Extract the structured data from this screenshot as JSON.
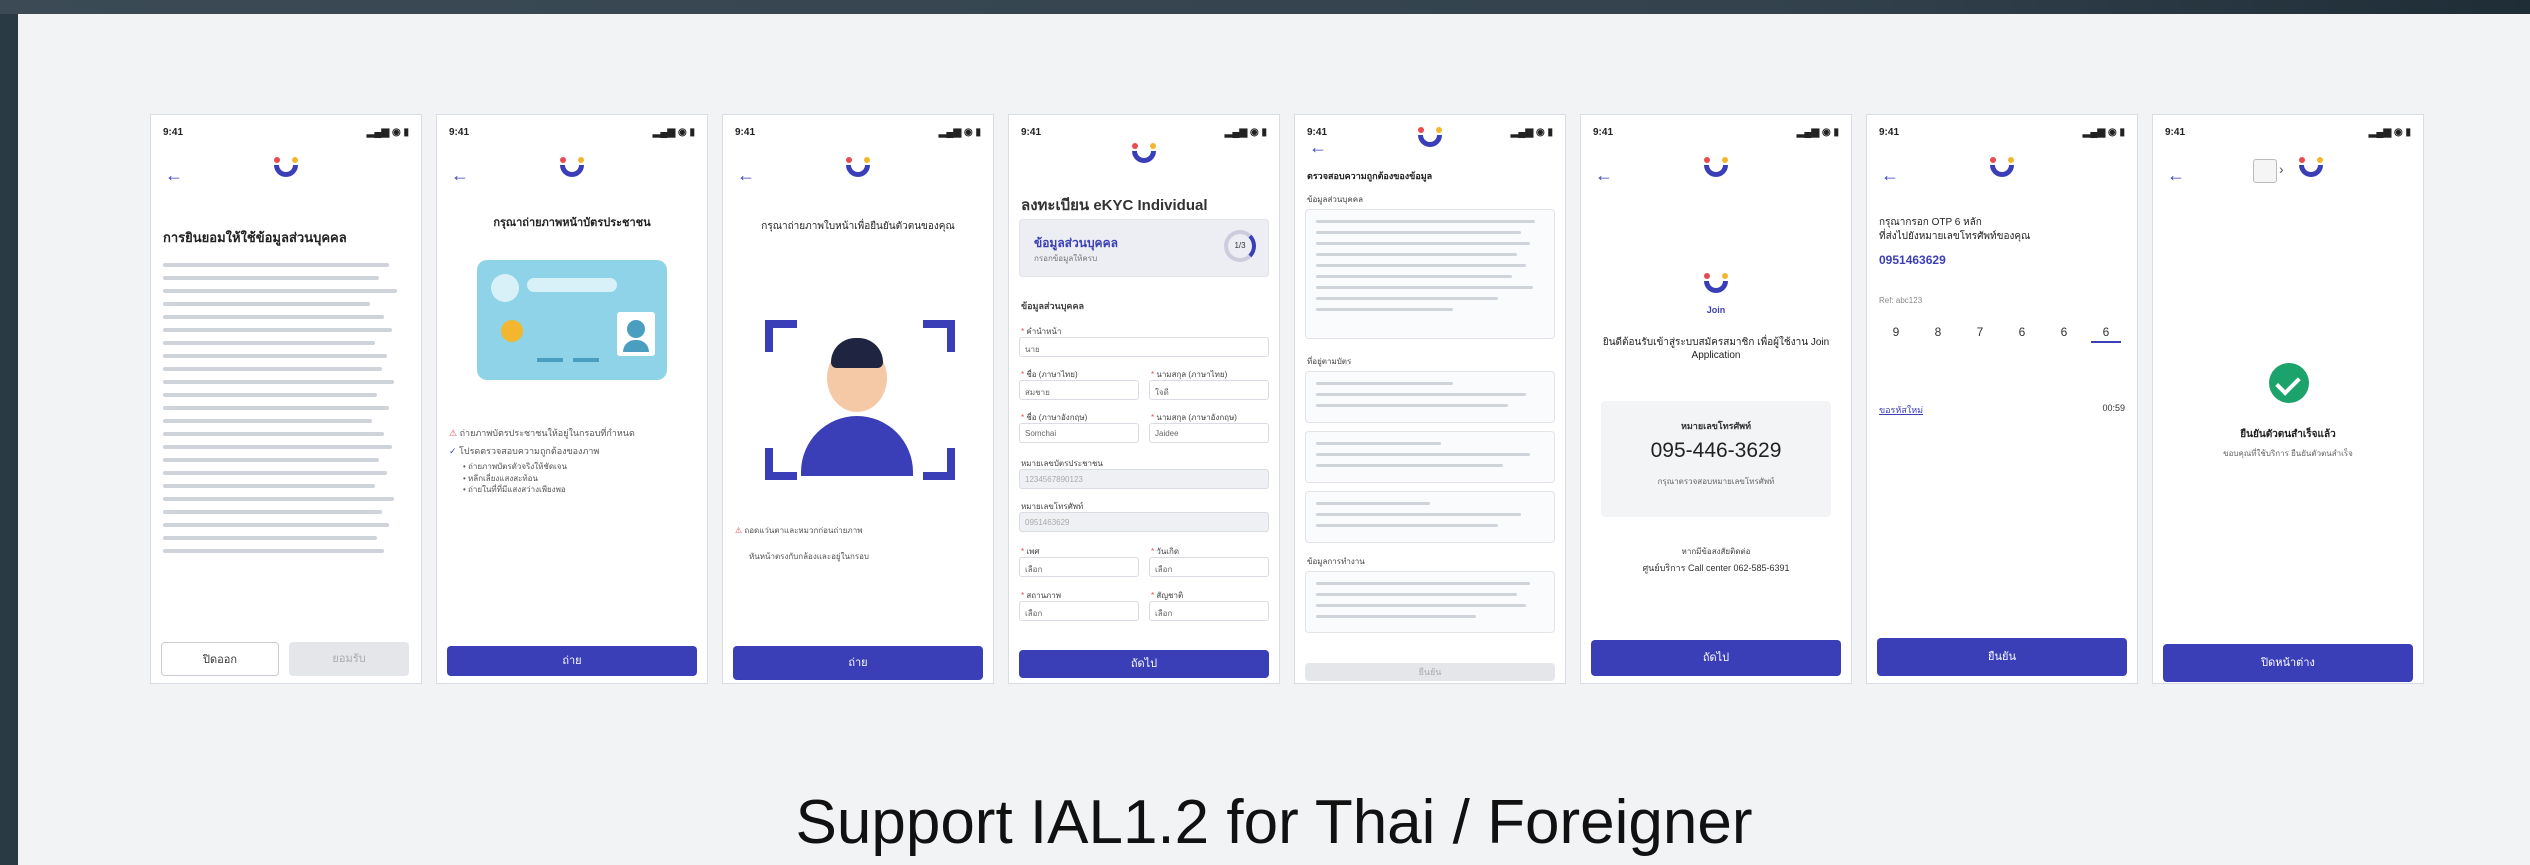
{
  "caption": "Support IAL1.2 for Thai / Foreigner",
  "colors": {
    "brand": "#3a3fb8",
    "red": "#e94b52",
    "yellow": "#f2b72f",
    "success": "#1ca36b"
  },
  "status_time": "9:41",
  "status_icons": "▂▄▆ ◉ ▮",
  "screens": {
    "s1": {
      "title": "การยินยอมให้ใช้ข้อมูลส่วนบุคคล",
      "cancel": "ปิดออก",
      "accept": "ยอมรับ"
    },
    "s2": {
      "title": "กรุณาถ่ายภาพหน้าบัตรประชาชน",
      "tip1": "ถ่ายภาพบัตรประชาชนให้อยู่ในกรอบที่กำหนด",
      "tip2": "โปรดตรวจสอบความถูกต้องของภาพ",
      "bullets": [
        "ถ่ายภาพบัตรตัวจริงให้ชัดเจน",
        "หลีกเลี่ยงแสงสะท้อน",
        "ถ่ายในที่ที่มีแสงสว่างเพียงพอ"
      ],
      "btn": "ถ่าย"
    },
    "s3": {
      "title": "กรุณาถ่ายภาพใบหน้าเพื่อยืนยันตัวตนของคุณ",
      "tip1": "ถอดแว่นตาและหมวกก่อนถ่ายภาพ",
      "tip2": "หันหน้าตรงกับกล้องและอยู่ในกรอบ",
      "btn": "ถ่าย"
    },
    "s4": {
      "title": "ลงทะเบียน eKYC Individual",
      "step_title": "ข้อมูลส่วนบุคคล",
      "step_sub": "กรอกข้อมูลให้ครบ",
      "step_count": "1/3",
      "section": "ข้อมูลส่วนบุคคล",
      "fields": [
        {
          "label": "คำนำหน้า",
          "value": "นาย"
        },
        {
          "label": "ชื่อ (ภาษาไทย)",
          "value": "สมชาย"
        },
        {
          "label": "นามสกุล (ภาษาไทย)",
          "value": "ใจดี"
        },
        {
          "label": "ชื่อ (ภาษาอังกฤษ)",
          "value": "Somchai"
        },
        {
          "label": "นามสกุล (ภาษาอังกฤษ)",
          "value": "Jaidee"
        },
        {
          "label": "หมายเลขบัตรประชาชน",
          "value": "1234567890123"
        },
        {
          "label": "หมายเลขโทรศัพท์",
          "value": "0951463629"
        },
        {
          "label": "เพศ",
          "value": "เลือก"
        },
        {
          "label": "วันเกิด",
          "value": "เลือก"
        },
        {
          "label": "สถานภาพ",
          "value": "เลือก"
        },
        {
          "label": "สัญชาติ",
          "value": "เลือก"
        }
      ],
      "btn": "ถัดไป"
    },
    "s5": {
      "title": "ตรวจสอบความถูกต้องของข้อมูล",
      "s1": "ข้อมูลส่วนบุคคล",
      "s2": "ที่อยู่ตามบัตร",
      "s3": "ข้อมูลการทำงาน",
      "btn": "ยืนยัน"
    },
    "s6": {
      "brand": "Join",
      "heading": "ยินดีต้อนรับเข้าสู่ระบบสมัครสมาชิก เพื่อผู้ใช้งาน Join Application",
      "phone_label": "หมายเลขโทรศัพท์",
      "phone": "095-446-3629",
      "phone_note": "กรุณาตรวจสอบหมายเลขโทรศัพท์",
      "help1": "หากมีข้อสงสัยติดต่อ",
      "help2": "ศูนย์บริการ Call center 062-585-6391",
      "btn": "ถัดไป"
    },
    "s7": {
      "title1": "กรุณากรอก OTP 6 หลัก",
      "title2": "ที่ส่งไปยังหมายเลขโทรศัพท์ของคุณ",
      "phone": "0951463629",
      "ref": "Ref: abc123",
      "otp": [
        "9",
        "8",
        "7",
        "6",
        "6",
        "6"
      ],
      "resend": "ขอรหัสใหม่",
      "timer": "00:59",
      "btn": "ยืนยัน"
    },
    "s8": {
      "title": "ยืนยันตัวตนสำเร็จแล้ว",
      "sub": "ขอบคุณที่ใช้บริการ ยืนยันตัวตนสำเร็จ",
      "btn": "ปิดหน้าต่าง"
    }
  }
}
